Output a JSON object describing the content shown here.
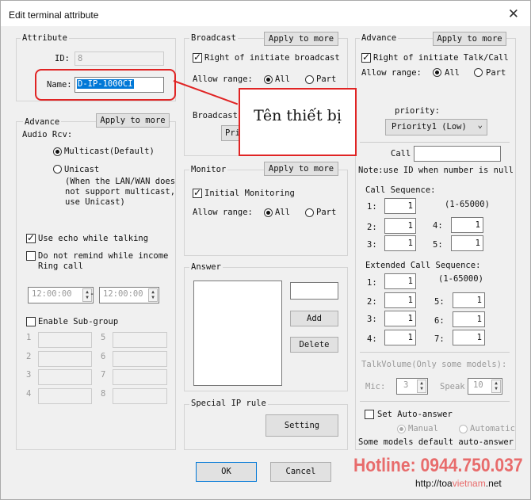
{
  "window": {
    "title": "Edit terminal attribute",
    "close": "✕"
  },
  "attribute": {
    "legend": "Attribute",
    "id_label": "ID:",
    "id_value": "8",
    "name_label": "Name:",
    "name_value": "D-IP-1000CI"
  },
  "advance_audio": {
    "legend": "Advance",
    "apply": "Apply to more",
    "audio_rcv": "Audio Rcv:",
    "multicast": "Multicast(Default)",
    "unicast": "Unicast",
    "unicast_note": [
      "(When the LAN/WAN does",
      "not support multicast,",
      "use Unicast)"
    ],
    "use_echo": "Use echo while talking",
    "do_not_remind": "Do not remind while income",
    "ring_call": "Ring call",
    "time_from": "12:00:00",
    "time_dash": "-",
    "time_to": "12:00:00",
    "enable_subgroup": "Enable Sub-group",
    "subgroup_numbers": [
      "1",
      "5",
      "2",
      "6",
      "3",
      "7",
      "4",
      "8"
    ]
  },
  "broadcast": {
    "legend": "Broadcast",
    "apply": "Apply to more",
    "right": "Right of initiate broadcast",
    "allow_range": "Allow range:",
    "all": "All",
    "part": "Part",
    "legend2": "Broadcast",
    "priority_btn": "Pri"
  },
  "monitor": {
    "legend": "Monitor",
    "apply": "Apply to more",
    "initial": "Initial Monitoring",
    "allow_range": "Allow range:",
    "all": "All",
    "part": "Part"
  },
  "answer": {
    "legend": "Answer",
    "add": "Add",
    "delete": "Delete"
  },
  "special_ip": {
    "legend": "Special IP rule",
    "setting": "Setting"
  },
  "advance_talk": {
    "legend": "Advance",
    "apply": "Apply to more",
    "right": "Right of initiate Talk/Call",
    "allow_range": "Allow range:",
    "all": "All",
    "part": "Part",
    "priority_label": "priority:",
    "priority_value": "Priority1 (Low)",
    "call_label": "Call",
    "note": "Note:use ID when number is null",
    "call_seq": "Call Sequence:",
    "call_range": "(1-65000)",
    "seq": [
      [
        "1:",
        "1"
      ],
      [
        "4:",
        "1"
      ],
      [
        "2:",
        "1"
      ],
      [
        "3:",
        "1"
      ],
      [
        "5:",
        "1"
      ]
    ],
    "ext_seq": "Extended Call Sequence:",
    "ext_range": "(1-65000)",
    "ext": [
      [
        "1:",
        "1"
      ],
      [
        "2:",
        "1"
      ],
      [
        "5:",
        "1"
      ],
      [
        "3:",
        "1"
      ],
      [
        "6:",
        "1"
      ],
      [
        "4:",
        "1"
      ],
      [
        "7:",
        "1"
      ]
    ],
    "talk_volume": "TalkVolume(Only some models):",
    "mic": "Mic:",
    "mic_value": "3",
    "speak": "Speak",
    "speak_value": "10",
    "auto_answer": "Set Auto-answer",
    "manual": "Manual",
    "automatic": "Automatic",
    "auto_note": "Some models default auto-answer"
  },
  "footer": {
    "ok": "OK",
    "cancel": "Cancel"
  },
  "callout": {
    "text": "Tên thiết bị"
  },
  "watermark": {
    "hotline": "Hotline: 0944.750.037",
    "url_prefix": "http://toa",
    "url_accent": "vietnam",
    "url_suffix": ".net"
  },
  "colors": {
    "highlight": "#e02424",
    "selection": "#0078d7",
    "hotline": "#e86c6c"
  }
}
